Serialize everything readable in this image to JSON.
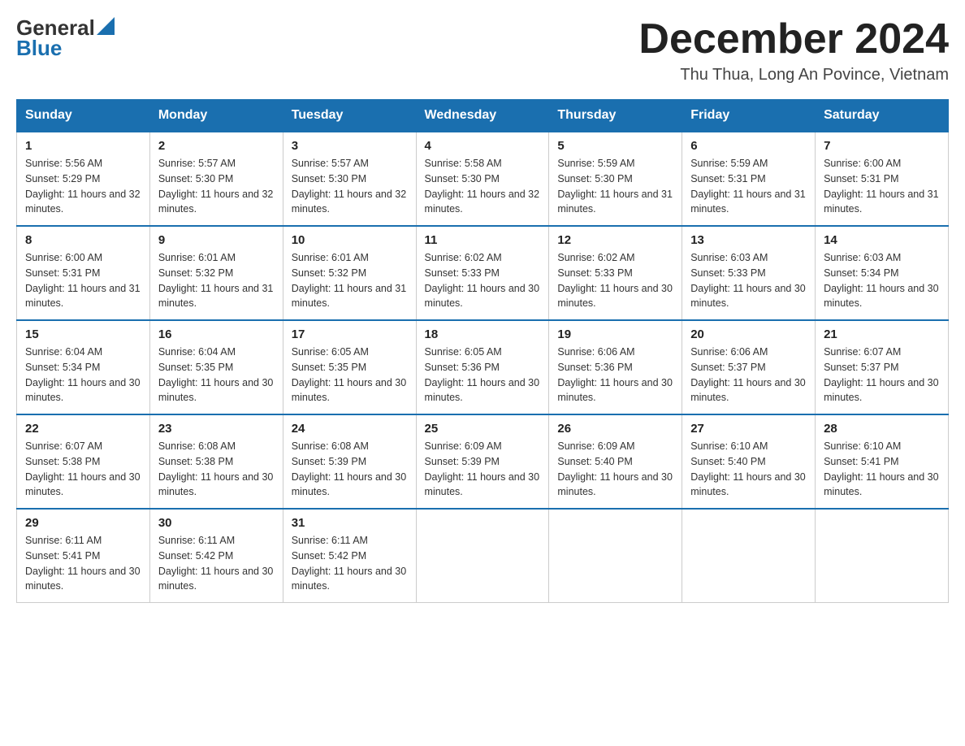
{
  "header": {
    "logo": {
      "general": "General",
      "blue": "Blue"
    },
    "title": "December 2024",
    "location": "Thu Thua, Long An Povince, Vietnam"
  },
  "calendar": {
    "days_of_week": [
      "Sunday",
      "Monday",
      "Tuesday",
      "Wednesday",
      "Thursday",
      "Friday",
      "Saturday"
    ],
    "weeks": [
      [
        {
          "day": "1",
          "sunrise": "5:56 AM",
          "sunset": "5:29 PM",
          "daylight": "11 hours and 32 minutes."
        },
        {
          "day": "2",
          "sunrise": "5:57 AM",
          "sunset": "5:30 PM",
          "daylight": "11 hours and 32 minutes."
        },
        {
          "day": "3",
          "sunrise": "5:57 AM",
          "sunset": "5:30 PM",
          "daylight": "11 hours and 32 minutes."
        },
        {
          "day": "4",
          "sunrise": "5:58 AM",
          "sunset": "5:30 PM",
          "daylight": "11 hours and 32 minutes."
        },
        {
          "day": "5",
          "sunrise": "5:59 AM",
          "sunset": "5:30 PM",
          "daylight": "11 hours and 31 minutes."
        },
        {
          "day": "6",
          "sunrise": "5:59 AM",
          "sunset": "5:31 PM",
          "daylight": "11 hours and 31 minutes."
        },
        {
          "day": "7",
          "sunrise": "6:00 AM",
          "sunset": "5:31 PM",
          "daylight": "11 hours and 31 minutes."
        }
      ],
      [
        {
          "day": "8",
          "sunrise": "6:00 AM",
          "sunset": "5:31 PM",
          "daylight": "11 hours and 31 minutes."
        },
        {
          "day": "9",
          "sunrise": "6:01 AM",
          "sunset": "5:32 PM",
          "daylight": "11 hours and 31 minutes."
        },
        {
          "day": "10",
          "sunrise": "6:01 AM",
          "sunset": "5:32 PM",
          "daylight": "11 hours and 31 minutes."
        },
        {
          "day": "11",
          "sunrise": "6:02 AM",
          "sunset": "5:33 PM",
          "daylight": "11 hours and 30 minutes."
        },
        {
          "day": "12",
          "sunrise": "6:02 AM",
          "sunset": "5:33 PM",
          "daylight": "11 hours and 30 minutes."
        },
        {
          "day": "13",
          "sunrise": "6:03 AM",
          "sunset": "5:33 PM",
          "daylight": "11 hours and 30 minutes."
        },
        {
          "day": "14",
          "sunrise": "6:03 AM",
          "sunset": "5:34 PM",
          "daylight": "11 hours and 30 minutes."
        }
      ],
      [
        {
          "day": "15",
          "sunrise": "6:04 AM",
          "sunset": "5:34 PM",
          "daylight": "11 hours and 30 minutes."
        },
        {
          "day": "16",
          "sunrise": "6:04 AM",
          "sunset": "5:35 PM",
          "daylight": "11 hours and 30 minutes."
        },
        {
          "day": "17",
          "sunrise": "6:05 AM",
          "sunset": "5:35 PM",
          "daylight": "11 hours and 30 minutes."
        },
        {
          "day": "18",
          "sunrise": "6:05 AM",
          "sunset": "5:36 PM",
          "daylight": "11 hours and 30 minutes."
        },
        {
          "day": "19",
          "sunrise": "6:06 AM",
          "sunset": "5:36 PM",
          "daylight": "11 hours and 30 minutes."
        },
        {
          "day": "20",
          "sunrise": "6:06 AM",
          "sunset": "5:37 PM",
          "daylight": "11 hours and 30 minutes."
        },
        {
          "day": "21",
          "sunrise": "6:07 AM",
          "sunset": "5:37 PM",
          "daylight": "11 hours and 30 minutes."
        }
      ],
      [
        {
          "day": "22",
          "sunrise": "6:07 AM",
          "sunset": "5:38 PM",
          "daylight": "11 hours and 30 minutes."
        },
        {
          "day": "23",
          "sunrise": "6:08 AM",
          "sunset": "5:38 PM",
          "daylight": "11 hours and 30 minutes."
        },
        {
          "day": "24",
          "sunrise": "6:08 AM",
          "sunset": "5:39 PM",
          "daylight": "11 hours and 30 minutes."
        },
        {
          "day": "25",
          "sunrise": "6:09 AM",
          "sunset": "5:39 PM",
          "daylight": "11 hours and 30 minutes."
        },
        {
          "day": "26",
          "sunrise": "6:09 AM",
          "sunset": "5:40 PM",
          "daylight": "11 hours and 30 minutes."
        },
        {
          "day": "27",
          "sunrise": "6:10 AM",
          "sunset": "5:40 PM",
          "daylight": "11 hours and 30 minutes."
        },
        {
          "day": "28",
          "sunrise": "6:10 AM",
          "sunset": "5:41 PM",
          "daylight": "11 hours and 30 minutes."
        }
      ],
      [
        {
          "day": "29",
          "sunrise": "6:11 AM",
          "sunset": "5:41 PM",
          "daylight": "11 hours and 30 minutes."
        },
        {
          "day": "30",
          "sunrise": "6:11 AM",
          "sunset": "5:42 PM",
          "daylight": "11 hours and 30 minutes."
        },
        {
          "day": "31",
          "sunrise": "6:11 AM",
          "sunset": "5:42 PM",
          "daylight": "11 hours and 30 minutes."
        },
        null,
        null,
        null,
        null
      ]
    ]
  }
}
